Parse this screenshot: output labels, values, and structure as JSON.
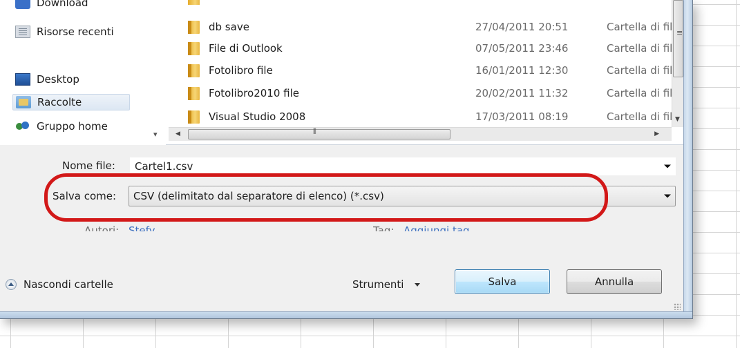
{
  "nav": {
    "items": [
      {
        "label": "Download",
        "icon": "download-icon"
      },
      {
        "label": "Risorse recenti",
        "icon": "recent-places-icon"
      },
      {
        "label": "Desktop",
        "icon": "desktop-icon"
      },
      {
        "label": "Raccolte",
        "icon": "libraries-icon",
        "selected": true
      },
      {
        "label": "Gruppo home",
        "icon": "homegroup-icon"
      }
    ]
  },
  "files": [
    {
      "name": "db save",
      "date": "27/04/2011 20:51",
      "type": "Cartella di file"
    },
    {
      "name": "File di Outlook",
      "date": "07/05/2011 23:46",
      "type": "Cartella di file"
    },
    {
      "name": "Fotolibro file",
      "date": "16/01/2011 12:30",
      "type": "Cartella di file"
    },
    {
      "name": "Fotolibro2010 file",
      "date": "20/02/2011 11:32",
      "type": "Cartella di file"
    },
    {
      "name": "Visual Studio 2008",
      "date": "17/03/2011 08:19",
      "type": "Cartella di file"
    }
  ],
  "form": {
    "filename_label": "Nome file:",
    "filename_value": "Cartel1.csv",
    "savetype_label": "Salva come:",
    "savetype_value": "CSV (delimitato dal separatore di elenco) (*.csv)",
    "authors_label": "Autori:",
    "authors_value": "Stefy",
    "tags_label": "Tag:",
    "tags_value": "Aggiungi tag"
  },
  "footer": {
    "hide_folders": "Nascondi cartelle",
    "tools": "Strumenti",
    "save": "Salva",
    "cancel": "Annulla"
  },
  "colors": {
    "highlight": "#d21818",
    "link": "#3c6fbf"
  }
}
